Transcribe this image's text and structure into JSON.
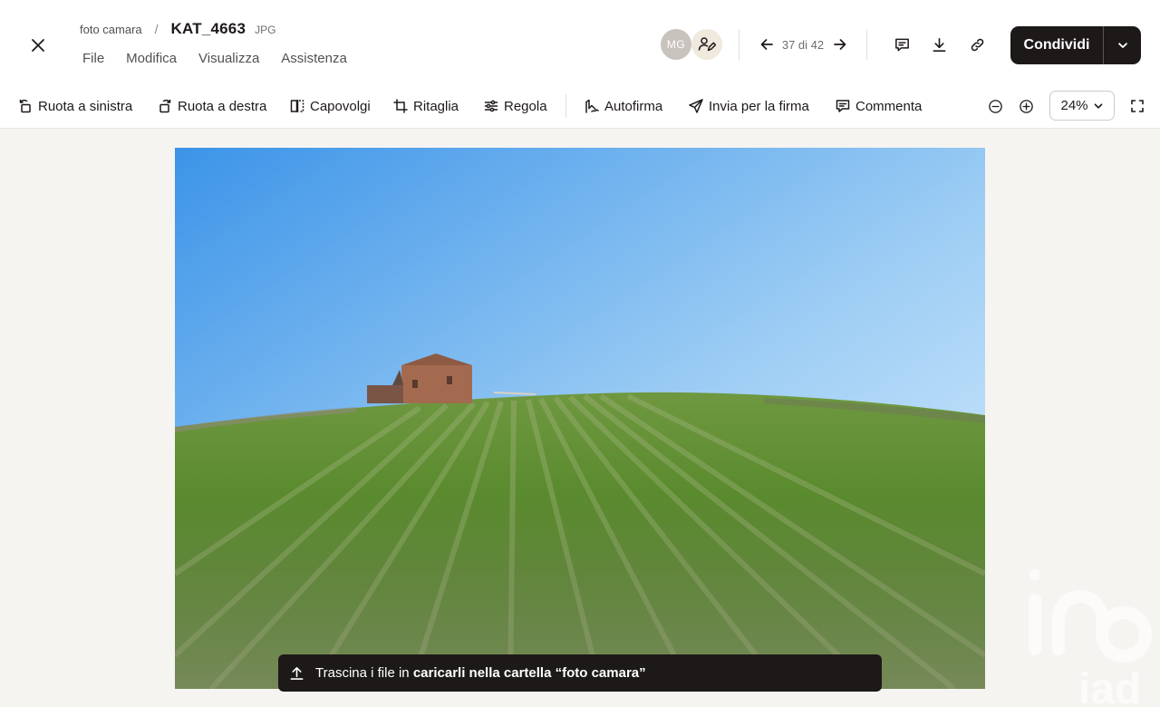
{
  "header": {
    "folder_name": "foto camara",
    "breadcrumb_separator": "/",
    "file_name": "KAT_4663",
    "file_ext": "JPG",
    "menu": [
      "File",
      "Modifica",
      "Visualizza",
      "Assistenza"
    ],
    "avatar_initials": "MG",
    "page_counter": "37 di 42",
    "share_label": "Condividi"
  },
  "toolbar": {
    "tools": [
      {
        "label": "Ruota a sinistra",
        "icon": "rotate-left-icon"
      },
      {
        "label": "Ruota a destra",
        "icon": "rotate-right-icon"
      },
      {
        "label": "Capovolgi",
        "icon": "flip-icon"
      },
      {
        "label": "Ritaglia",
        "icon": "crop-icon"
      },
      {
        "label": "Regola",
        "icon": "adjust-icon"
      },
      {
        "label": "Autofirma",
        "icon": "self-sign-icon"
      },
      {
        "label": "Invia per la firma",
        "icon": "send-signature-icon"
      },
      {
        "label": "Commenta",
        "icon": "comment-icon"
      }
    ],
    "zoom_level": "24%"
  },
  "upload_toast": {
    "prefix": "Trascina i file in",
    "bold_text": "caricarli nella cartella “foto camara”"
  },
  "watermark_text": "iad",
  "colors": {
    "primary_dark": "#1e1919",
    "canvas_bg": "#f6f4f1",
    "avatar_bg": "#c9c3bd"
  }
}
